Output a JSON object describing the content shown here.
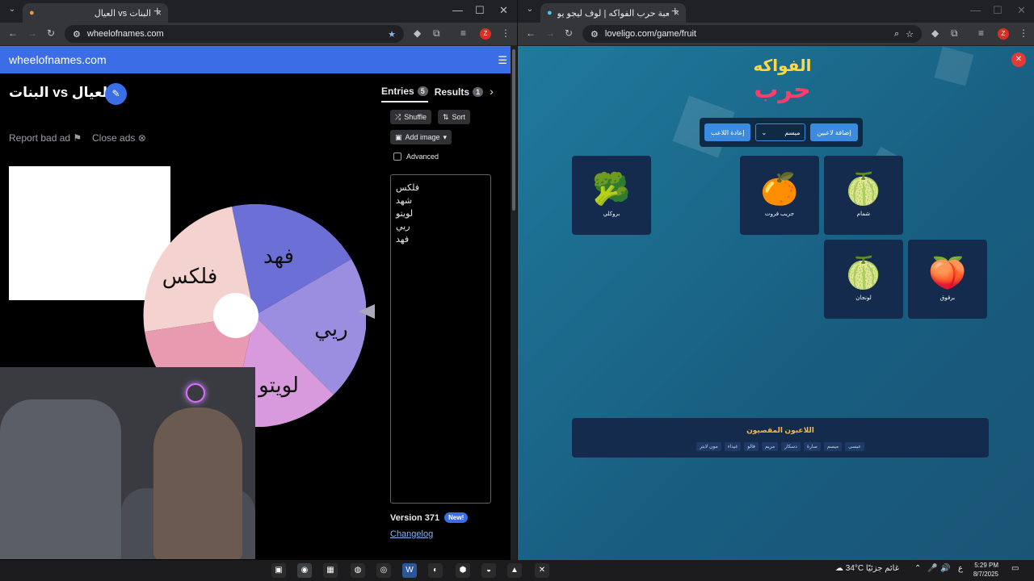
{
  "left": {
    "tab_title": "العيال vs البنات",
    "url": "wheelofnames.com",
    "site_name": "wheelofnames.com",
    "wheel_title": "البنات vs العيال",
    "report_ad": "Report bad ad",
    "close_ads": "Close ads",
    "tab_entries": "Entries",
    "entries_count": "5",
    "tab_results": "Results",
    "results_count": "1",
    "shuffle": "Shuffle",
    "sort": "Sort",
    "add_image": "Add image",
    "advanced": "Advanced",
    "entries": [
      "فلكس",
      "شهد",
      "لويتو",
      "ريي",
      "فهد"
    ],
    "wheel_labels": [
      "فهد",
      "ريي",
      "لويتو",
      "شهد",
      "فلكس"
    ],
    "version": "Version 371",
    "new_badge": "New!",
    "changelog": "Changelog"
  },
  "right": {
    "tab_title": "لعبة حرب الفواكه | لوف ليجو يو...",
    "url": "loveligo.com/game/fruit",
    "logo_top": "الفواكه",
    "logo_main": "حرب",
    "add_players": "إضافة لاعبين",
    "selected_player": "ميسم",
    "reset_player": "إعادة اللاعب",
    "cards": [
      {
        "label": "بروكلي",
        "icon": "🥦"
      },
      {
        "label": "جريب فروت",
        "icon": "🍊"
      },
      {
        "label": "شمام",
        "icon": "🍈"
      },
      {
        "label": "لونجان",
        "icon": "🍈"
      },
      {
        "label": "برقوق",
        "icon": "🍑"
      }
    ],
    "eliminated_title": "اللاعبون المقصيون",
    "eliminated": [
      "عيسى",
      "ميسم",
      "سارة",
      "دسكار",
      "مريم",
      "فالو",
      "غيداء",
      "مون لايتر"
    ]
  },
  "taskbar": {
    "weather": "34°C",
    "weather_text": "غائم جزئيًا",
    "lang": "ع",
    "time": "5:29 PM",
    "date": "8/7/2025"
  },
  "colors": {
    "brand_blue": "#3b6ee6",
    "game_bg": "#1f7a9c",
    "card_bg": "#152b4d"
  }
}
